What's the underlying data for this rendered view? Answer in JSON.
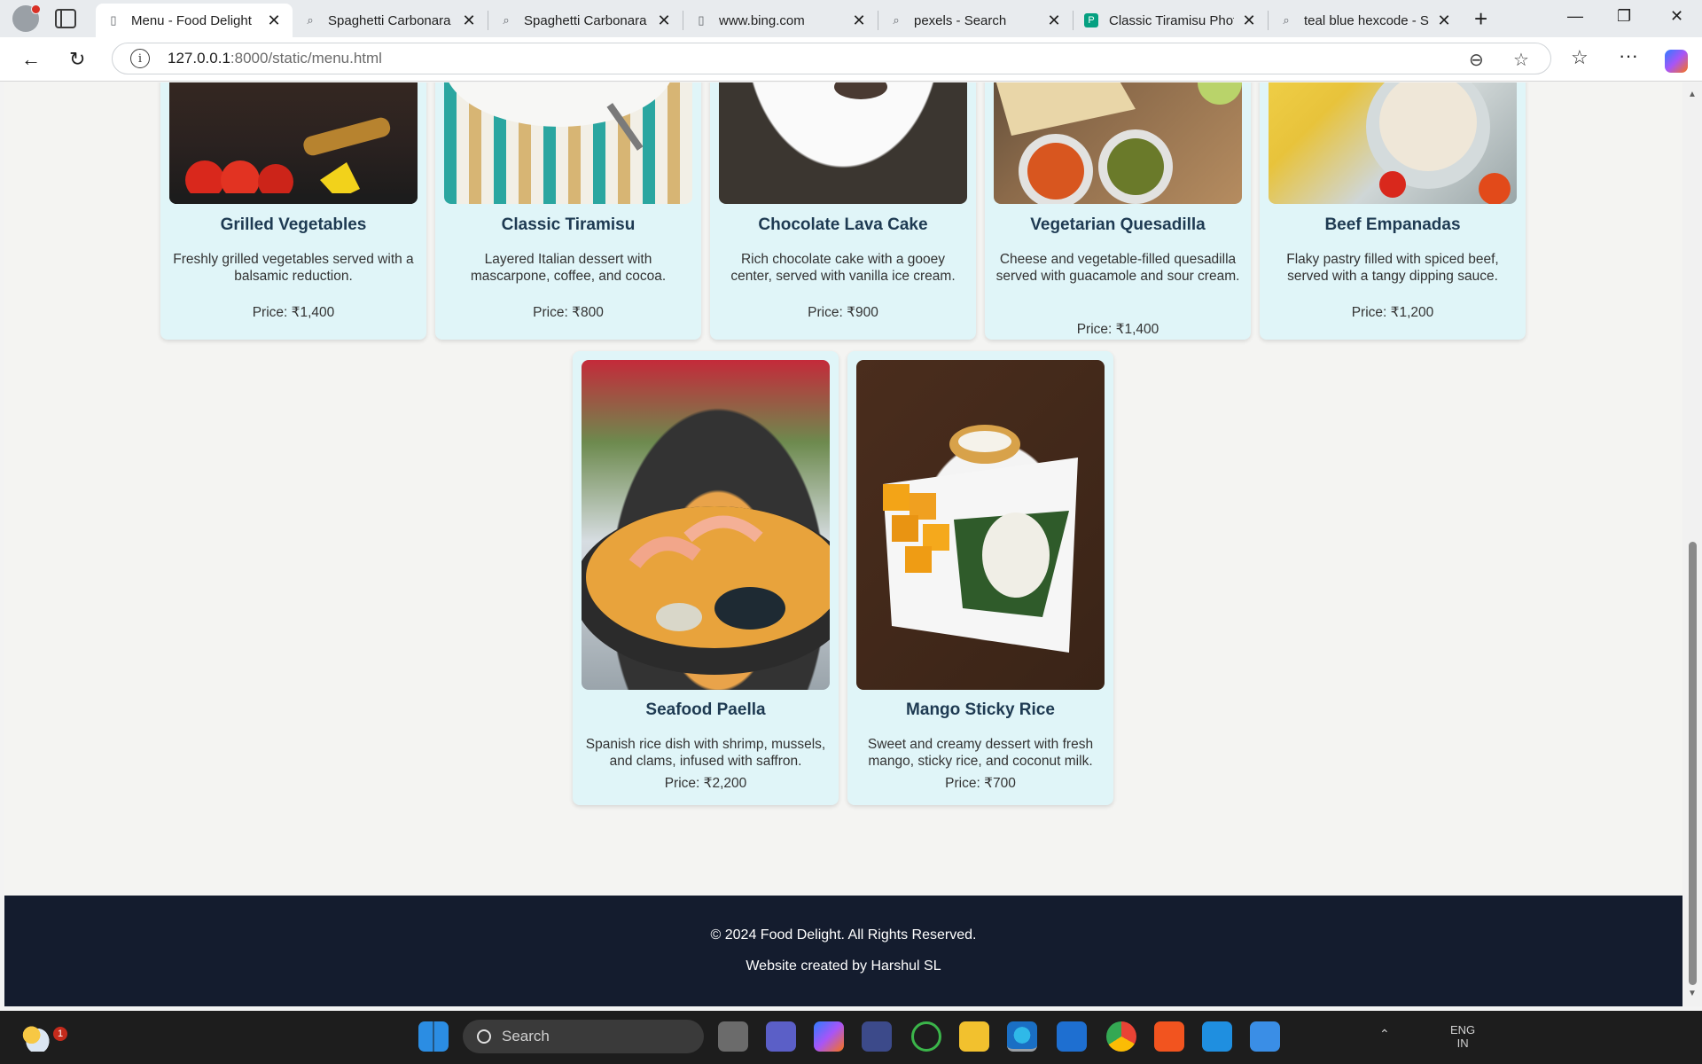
{
  "browser": {
    "tabs": [
      {
        "label": "Menu - Food Delight",
        "icon": "page-icon",
        "active": true
      },
      {
        "label": "Spaghetti Carbonara",
        "icon": "search-icon"
      },
      {
        "label": "Spaghetti Carbonara",
        "icon": "search-icon"
      },
      {
        "label": "www.bing.com",
        "icon": "page-icon"
      },
      {
        "label": "pexels - Search",
        "icon": "search-icon"
      },
      {
        "label": "Classic Tiramisu Photo",
        "icon": "pexels-icon"
      },
      {
        "label": "teal blue hexcode - Se",
        "icon": "search-icon"
      }
    ],
    "close_glyph": "✕",
    "new_tab_glyph": "+",
    "url_host": "127.0.0.1",
    "url_rest": ":8000/static/menu.html"
  },
  "menu_items": [
    {
      "name": "Grilled Vegetables",
      "description": "Freshly grilled vegetables served with a balsamic reduction.",
      "price": "Price: ₹1,400"
    },
    {
      "name": "Classic Tiramisu",
      "description": "Layered Italian dessert with mascarpone, coffee, and cocoa.",
      "price": "Price: ₹800"
    },
    {
      "name": "Chocolate Lava Cake",
      "description": "Rich chocolate cake with a gooey center, served with vanilla ice cream.",
      "price": "Price: ₹900"
    },
    {
      "name": "Vegetarian Quesadilla",
      "description": "Cheese and vegetable-filled quesadilla served with guacamole and sour cream.",
      "price": "Price: ₹1,400"
    },
    {
      "name": "Beef Empanadas",
      "description": "Flaky pastry filled with spiced beef, served with a tangy dipping sauce.",
      "price": "Price: ₹1,200"
    },
    {
      "name": "Seafood Paella",
      "description": "Spanish rice dish with shrimp, mussels, and clams, infused with saffron.",
      "price": "Price: ₹2,200"
    },
    {
      "name": "Mango Sticky Rice",
      "description": "Sweet and creamy dessert with fresh mango, sticky rice, and coconut milk.",
      "price": "Price: ₹700"
    }
  ],
  "footer": {
    "copyright": "© 2024 Food Delight. All Rights Reserved.",
    "credit": "Website created by Harshul SL"
  },
  "taskbar": {
    "search_placeholder": "Search",
    "weather_badge": "1",
    "lang_line1": "ENG",
    "lang_line2": "IN"
  },
  "colors": {
    "card_bg": "#e0f5f8",
    "title": "#1e3a52",
    "footer_bg": "#141c2e",
    "page_bg": "#f4f4f2"
  }
}
